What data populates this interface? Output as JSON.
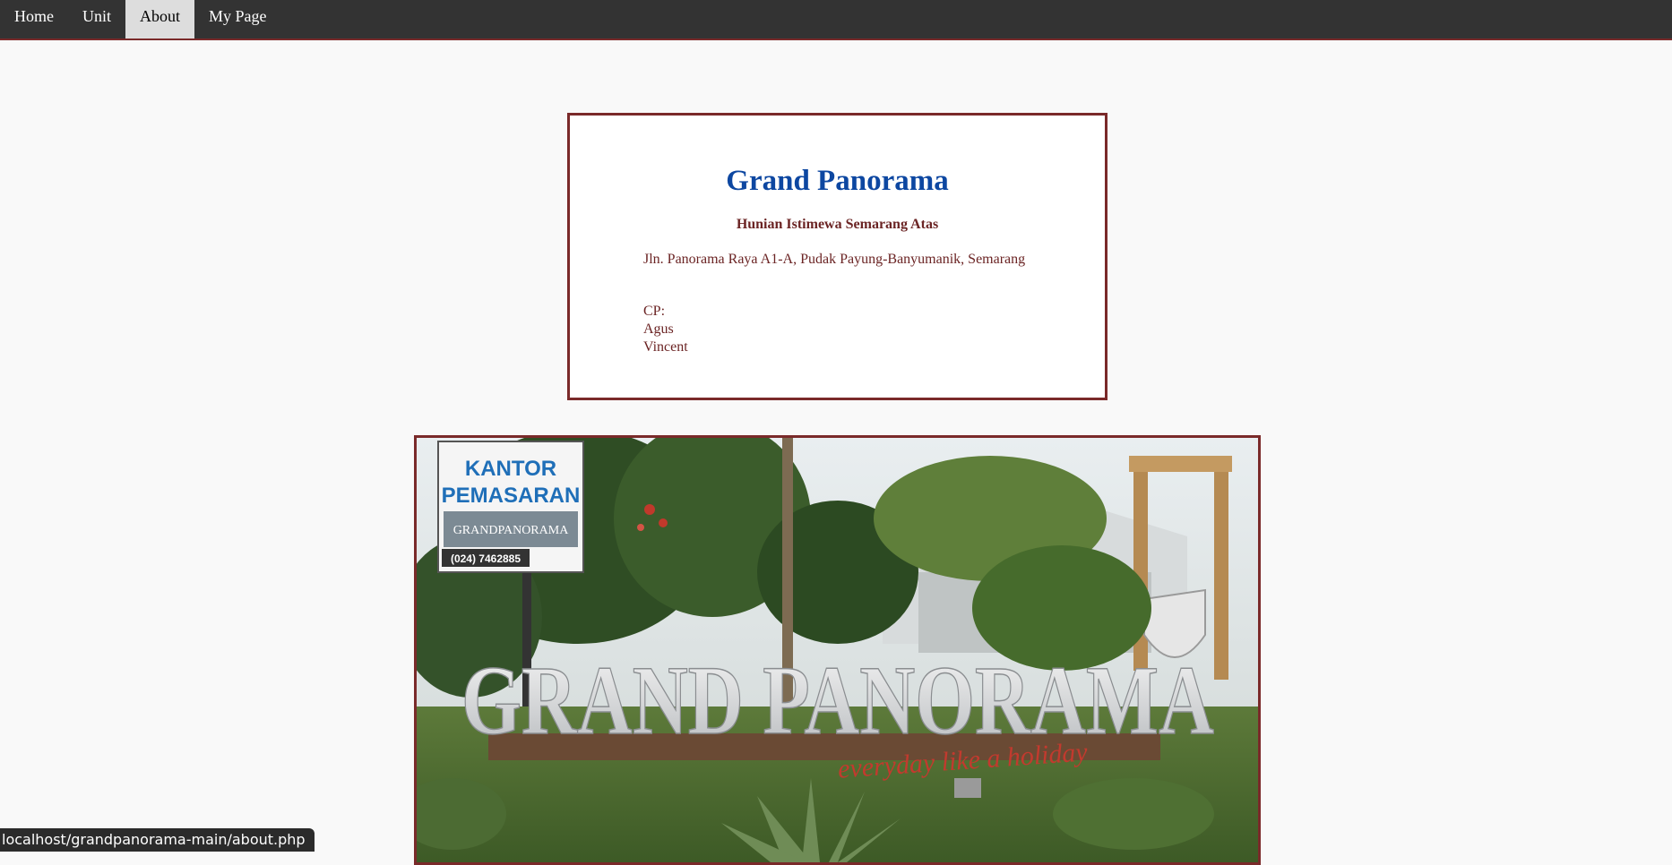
{
  "nav": {
    "items": [
      {
        "label": "Home"
      },
      {
        "label": "Unit"
      },
      {
        "label": "About",
        "active": true
      },
      {
        "label": "My Page"
      }
    ]
  },
  "card": {
    "title": "Grand Panorama",
    "subtitle": "Hunian Istimewa Semarang Atas",
    "address": "Jln. Panorama Raya A1-A, Pudak Payung-Banyumanik, Semarang",
    "contact_label": "CP:",
    "contacts": [
      "Agus",
      "Vincent"
    ]
  },
  "photo": {
    "sign_line1": "KANTOR",
    "sign_line2": "PEMASARAN",
    "sign_brand": "GRANDPANORAMA",
    "sign_phone": "(024) 7462885",
    "monument_text": "GRAND PANORAMA",
    "tagline": "everyday like a holiday"
  },
  "status_bar": {
    "url": "localhost/grandpanorama-main/about.php"
  },
  "colors": {
    "nav_bg": "#333333",
    "accent_border": "#7a2a2a",
    "title_blue": "#0d47a1",
    "text_maroon": "#6b2424"
  }
}
